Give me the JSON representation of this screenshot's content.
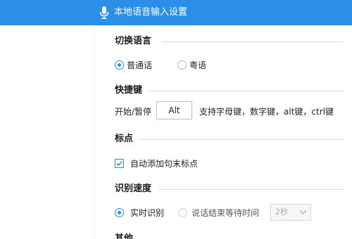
{
  "window": {
    "title": "本地语音输入设置",
    "title_icon": "microphone-icon",
    "accent_color": "#2b8fe8"
  },
  "sections": {
    "language": {
      "title": "切换语言",
      "options": [
        {
          "label": "普通话",
          "selected": true
        },
        {
          "label": "粤语",
          "selected": false
        }
      ]
    },
    "hotkey": {
      "title": "快捷键",
      "label": "开始/暂停",
      "value": "Alt",
      "hint": "支持字母键，数字键，alt键，ctrl键"
    },
    "punctuation": {
      "title": "标点",
      "checkbox_label": "自动添加句末标点",
      "checked": true
    },
    "speed": {
      "title": "识别速度",
      "options": [
        {
          "label": "实时识别",
          "selected": true
        },
        {
          "label": "说话结束等待时间",
          "selected": false
        }
      ],
      "wait_select": {
        "value": "2秒",
        "enabled": false
      }
    },
    "other": {
      "title": "其他"
    }
  }
}
